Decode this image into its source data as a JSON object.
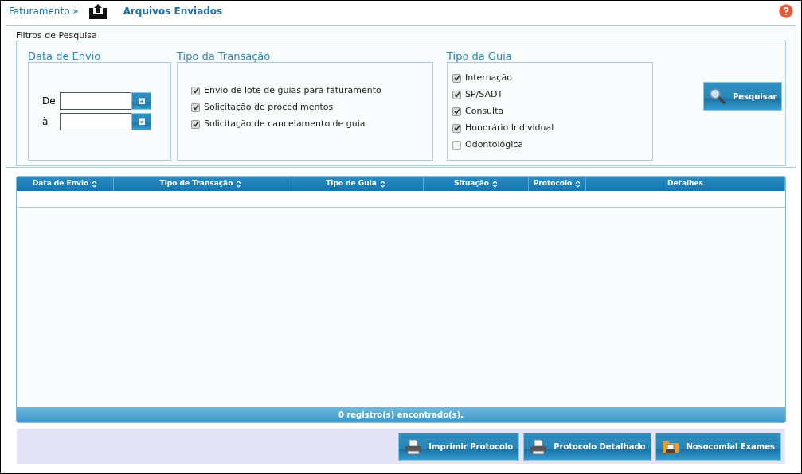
{
  "breadcrumb": {
    "parent": "Faturamento »",
    "title": "Arquivos Enviados"
  },
  "filters": {
    "legend": "Filtros de Pesquisa",
    "date_group": {
      "title": "Data de Envio",
      "from_label": "De",
      "to_label": "à"
    },
    "transaction_group": {
      "title": "Tipo da Transação",
      "options": [
        {
          "label": "Envio de lote de guias para faturamento",
          "checked": true
        },
        {
          "label": "Solicitação de procedimentos",
          "checked": true
        },
        {
          "label": "Solicitação de cancelamento de guia",
          "checked": true
        }
      ]
    },
    "guide_group": {
      "title": "Tipo da Guia",
      "options": [
        {
          "label": "Internação",
          "checked": true
        },
        {
          "label": "SP/SADT",
          "checked": true
        },
        {
          "label": "Consulta",
          "checked": true
        },
        {
          "label": "Honorário Individual",
          "checked": true
        },
        {
          "label": "Odontológica",
          "checked": false
        }
      ]
    },
    "search_button": "Pesquisar"
  },
  "table": {
    "columns": [
      {
        "label": "Data de Envio",
        "sortable": true
      },
      {
        "label": "Tipo de Transação",
        "sortable": true
      },
      {
        "label": "Tipo de Guia",
        "sortable": true
      },
      {
        "label": "Situação",
        "sortable": true
      },
      {
        "label": "Protocolo",
        "sortable": true
      },
      {
        "label": "Detalhes",
        "sortable": false
      }
    ],
    "footer": "0 registro(s) encontrado(s)."
  },
  "actions": [
    {
      "label": "Imprimir Protocolo",
      "kind": "printer"
    },
    {
      "label": "Protocolo Detalhado",
      "kind": "printer"
    },
    {
      "label": "Nosocomial Exames",
      "kind": "folder"
    }
  ]
}
